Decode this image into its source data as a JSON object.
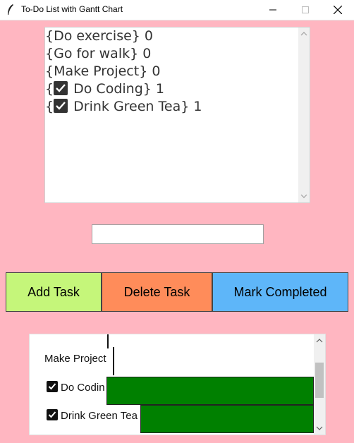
{
  "window": {
    "title": "To-Do List with Gantt Chart",
    "minimize_icon": "minimize-icon",
    "maximize_icon": "maximize-icon",
    "close_icon": "close-icon"
  },
  "todo_list": {
    "items": [
      {
        "prefix": "{",
        "text": "Do exercise} 0",
        "checked": false
      },
      {
        "prefix": "{",
        "text": "Go for walk} 0",
        "checked": false
      },
      {
        "prefix": "{",
        "text": "Make Project} 0",
        "checked": false
      },
      {
        "prefix": "{",
        "text": " Do Coding} 1",
        "checked": true
      },
      {
        "prefix": "{",
        "text": " Drink Green Tea} 1",
        "checked": true
      }
    ]
  },
  "task_entry": {
    "value": ""
  },
  "buttons": {
    "add_label": "Add Task",
    "delete_label": "Delete Task",
    "mark_label": "Mark Completed"
  },
  "colors": {
    "background": "#FFB6C1",
    "add_button": "#C5F67A",
    "delete_button": "#FF8C5A",
    "mark_button": "#5EB6F9",
    "gantt_bar": "#008000"
  },
  "gantt": {
    "rows": [
      {
        "label": "Make Project",
        "checked": false
      },
      {
        "label": "Do Codin",
        "checked": true
      },
      {
        "label": "Drink Green Tea",
        "checked": true
      }
    ]
  }
}
